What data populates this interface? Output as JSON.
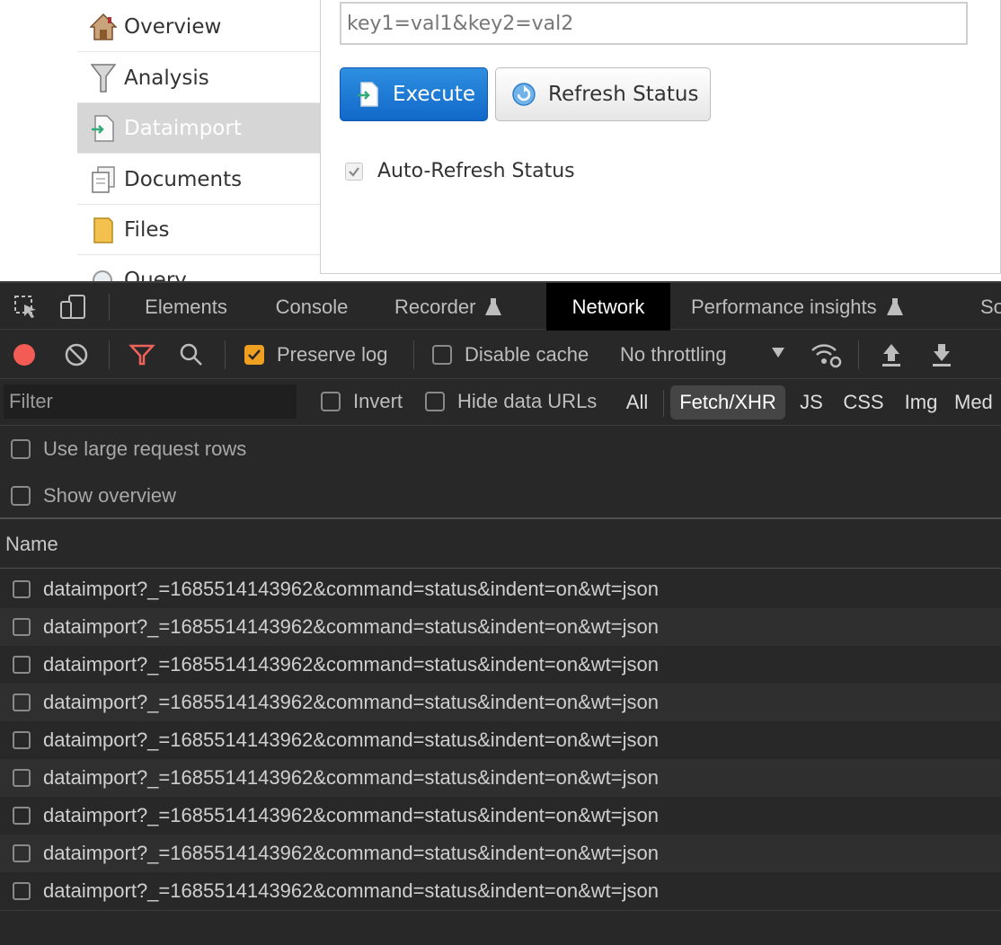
{
  "sidebar": {
    "items": [
      {
        "label": "Overview",
        "icon": "home-icon",
        "active": false
      },
      {
        "label": "Analysis",
        "icon": "funnel-icon",
        "active": false
      },
      {
        "label": "Dataimport",
        "icon": "import-icon",
        "active": true
      },
      {
        "label": "Documents",
        "icon": "documents-icon",
        "active": false
      },
      {
        "label": "Files",
        "icon": "folder-icon",
        "active": false
      },
      {
        "label": "Query",
        "icon": "magnifier-icon",
        "active": false
      }
    ]
  },
  "dataimport": {
    "params_value": "key1=val1&key2=val2",
    "execute_label": "Execute",
    "refresh_label": "Refresh Status",
    "auto_refresh_label": "Auto-Refresh Status",
    "auto_refresh_checked": true,
    "execute_color": "#1a75d2"
  },
  "devtools": {
    "tabs": [
      {
        "label": "Elements",
        "active": false
      },
      {
        "label": "Console",
        "active": false
      },
      {
        "label": "Recorder",
        "active": false,
        "icon": "flask-icon"
      },
      {
        "label": "Network",
        "active": true
      },
      {
        "label": "Performance insights",
        "active": false,
        "icon": "flask-icon"
      },
      {
        "label": "So",
        "active": false
      }
    ],
    "toolbar": {
      "preserve_log_label": "Preserve log",
      "preserve_log_checked": true,
      "disable_cache_label": "Disable cache",
      "disable_cache_checked": false,
      "throttling_value": "No throttling",
      "record_color": "#f25c54",
      "filter_active_color": "#f0625a",
      "checkbox_accent": "#f0a020"
    },
    "filterbar": {
      "filter_placeholder": "Filter",
      "invert_label": "Invert",
      "hide_data_urls_label": "Hide data URLs",
      "types": [
        "All",
        "Fetch/XHR",
        "JS",
        "CSS",
        "Img",
        "Med"
      ],
      "active_type": "Fetch/XHR"
    },
    "options": {
      "large_rows_label": "Use large request rows",
      "overview_label": "Show overview"
    },
    "table": {
      "name_header": "Name",
      "rows": [
        "dataimport?_=1685514143962&command=status&indent=on&wt=json",
        "dataimport?_=1685514143962&command=status&indent=on&wt=json",
        "dataimport?_=1685514143962&command=status&indent=on&wt=json",
        "dataimport?_=1685514143962&command=status&indent=on&wt=json",
        "dataimport?_=1685514143962&command=status&indent=on&wt=json",
        "dataimport?_=1685514143962&command=status&indent=on&wt=json",
        "dataimport?_=1685514143962&command=status&indent=on&wt=json",
        "dataimport?_=1685514143962&command=status&indent=on&wt=json",
        "dataimport?_=1685514143962&command=status&indent=on&wt=json"
      ]
    }
  }
}
